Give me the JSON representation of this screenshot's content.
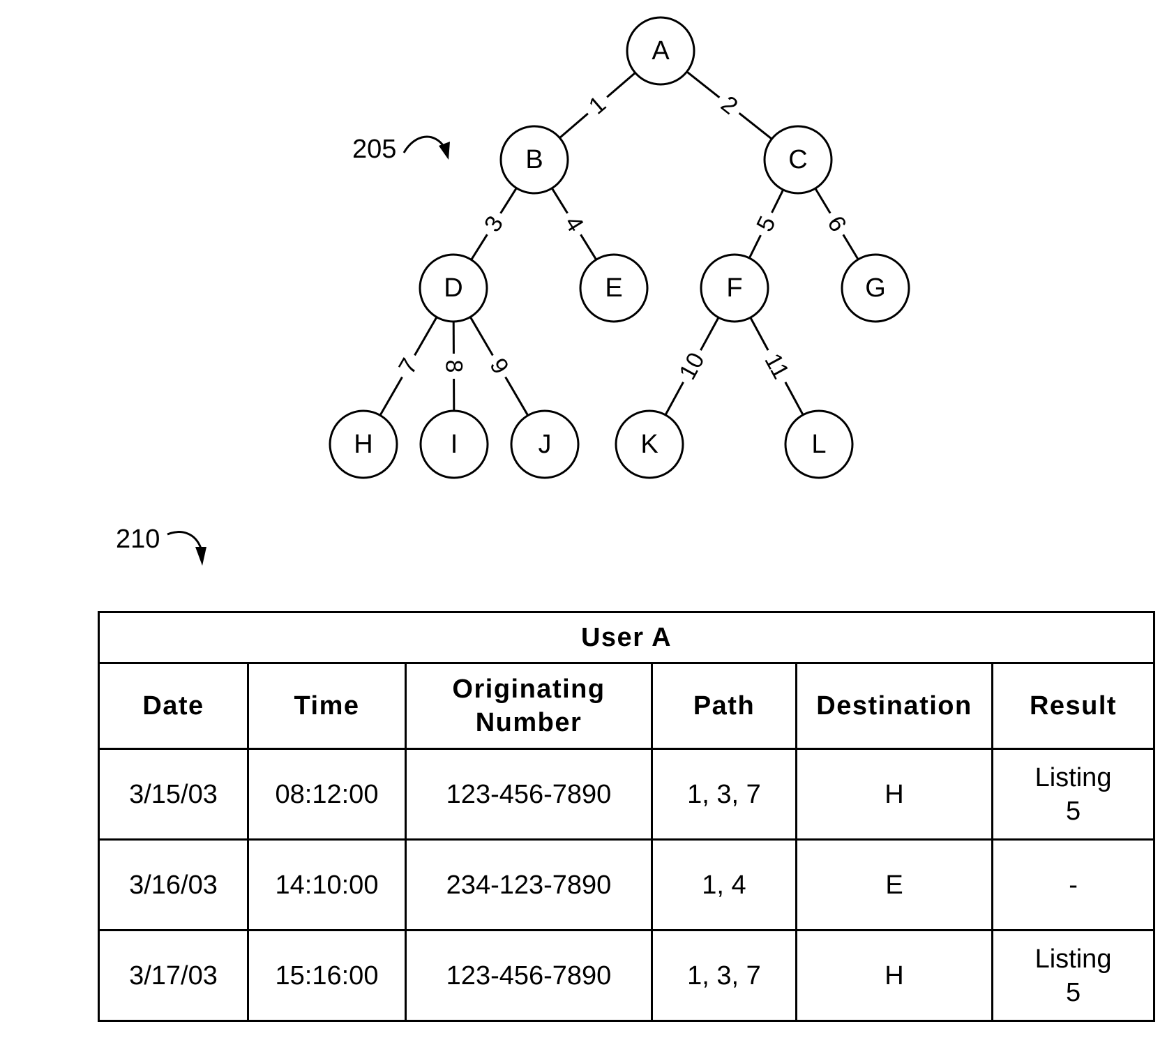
{
  "figure": {
    "tree_ref": "205",
    "table_ref": "210"
  },
  "tree": {
    "nodes": [
      {
        "id": "A",
        "label": "A"
      },
      {
        "id": "B",
        "label": "B"
      },
      {
        "id": "C",
        "label": "C"
      },
      {
        "id": "D",
        "label": "D"
      },
      {
        "id": "E",
        "label": "E"
      },
      {
        "id": "F",
        "label": "F"
      },
      {
        "id": "G",
        "label": "G"
      },
      {
        "id": "H",
        "label": "H"
      },
      {
        "id": "I",
        "label": "I"
      },
      {
        "id": "J",
        "label": "J"
      },
      {
        "id": "K",
        "label": "K"
      },
      {
        "id": "L",
        "label": "L"
      }
    ],
    "edges": [
      {
        "from": "A",
        "to": "B",
        "label": "1"
      },
      {
        "from": "A",
        "to": "C",
        "label": "2"
      },
      {
        "from": "B",
        "to": "D",
        "label": "3"
      },
      {
        "from": "B",
        "to": "E",
        "label": "4"
      },
      {
        "from": "C",
        "to": "F",
        "label": "5"
      },
      {
        "from": "C",
        "to": "G",
        "label": "6"
      },
      {
        "from": "D",
        "to": "H",
        "label": "7"
      },
      {
        "from": "D",
        "to": "I",
        "label": "8"
      },
      {
        "from": "D",
        "to": "J",
        "label": "9"
      },
      {
        "from": "F",
        "to": "K",
        "label": "10"
      },
      {
        "from": "F",
        "to": "L",
        "label": "11"
      }
    ]
  },
  "table": {
    "title": "User A",
    "headers": [
      "Date",
      "Time",
      "Originating\nNumber",
      "Path",
      "Destination",
      "Result"
    ],
    "rows": [
      [
        "3/15/03",
        "08:12:00",
        "123-456-7890",
        "1, 3, 7",
        "H",
        "Listing\n5"
      ],
      [
        "3/16/03",
        "14:10:00",
        "234-123-7890",
        "1, 4",
        "E",
        "-"
      ],
      [
        "3/17/03",
        "15:16:00",
        "123-456-7890",
        "1, 3, 7",
        "H",
        "Listing\n5"
      ]
    ]
  }
}
